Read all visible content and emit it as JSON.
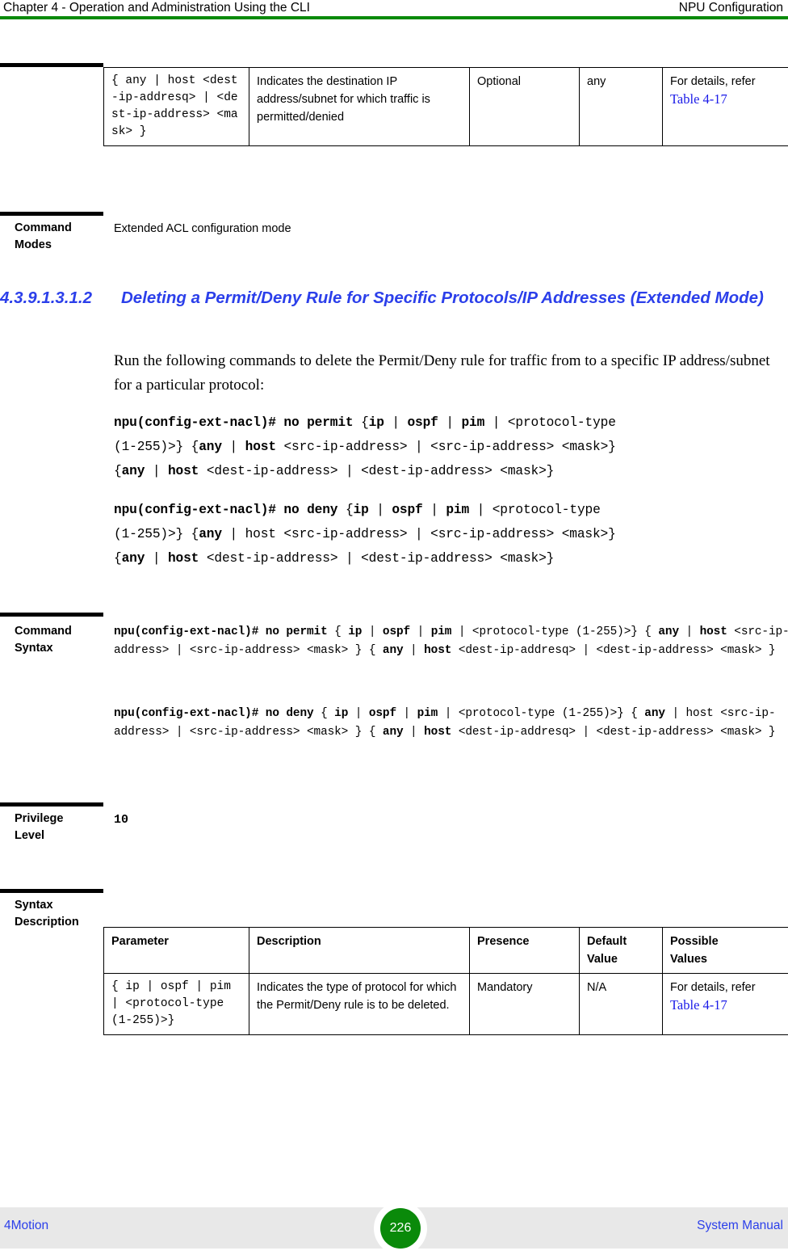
{
  "header": {
    "left": "Chapter 4 - Operation and Administration Using the CLI",
    "right": "NPU Configuration",
    "rule_color": "#0a8a0a"
  },
  "top_table": {
    "row": {
      "parameter": "{ any | host <dest-ip-addresq> | <dest-ip-address> <mask> }",
      "description": "Indicates the destination IP address/subnet for which traffic is permitted/denied",
      "presence": "Optional",
      "default_value": "any",
      "possible_values_prefix": "For details, refer",
      "possible_values_link": "Table 4-17"
    }
  },
  "command_modes": {
    "label_line1": "Command",
    "label_line2": "Modes",
    "value": "Extended ACL configuration mode"
  },
  "heading": {
    "number": "4.3.9.1.3.1.2",
    "text": "Deleting a Permit/Deny Rule for Specific Protocols/IP Addresses (Extended Mode)",
    "color": "#2b3fea"
  },
  "intro_paragraph": "Run the following commands to delete the Permit/Deny rule for traffic from to a specific IP address/subnet for a particular protocol:",
  "cli_commands": {
    "permit": {
      "line1_bold_a": "npu(config-ext-nacl)# no permit ",
      "line1_rest_open": "{",
      "line1_ip": "ip",
      "line1_sep1": " | ",
      "line1_ospf": "ospf",
      "line1_sep2": " | ",
      "line1_pim": "pim",
      "line1_sep3": " | ",
      "line1_tail": "<protocol-type",
      "line2_a": "(1-255)>} {",
      "line2_any": "any",
      "line2_b": " | ",
      "line2_host": "host",
      "line2_c": " <src-ip-address> | <src-ip-address> <mask>}",
      "line3_open": "{",
      "line3_any": "any",
      "line3_b": " | ",
      "line3_host": "host",
      "line3_c": " <dest-ip-address> | <dest-ip-address> <mask>}"
    },
    "deny": {
      "line1_bold_a": "npu(config-ext-nacl)# no deny ",
      "line1_rest_open": "{",
      "line1_ip": "ip",
      "line1_sep1": " | ",
      "line1_ospf": "ospf",
      "line1_sep2": " | ",
      "line1_pim": "pim",
      "line1_sep3": " | ",
      "line1_tail": "<protocol-type",
      "line2_a": "(1-255)>} {",
      "line2_any": "any",
      "line2_b": " | host <src-ip-address> | <src-ip-address> <mask>}",
      "line3_open": "{",
      "line3_any": "any",
      "line3_b": " | ",
      "line3_host": "host",
      "line3_c": " <dest-ip-address> | <dest-ip-address> <mask>}"
    }
  },
  "command_syntax": {
    "label_line1": "Command",
    "label_line2": "Syntax",
    "permit": {
      "p1": "npu(config-ext-nacl)# no permit",
      "p2": " { ",
      "p3": "ip",
      "p4": " | ",
      "p5": "ospf",
      "p6": " | ",
      "p7": "pim",
      "p8": " | <protocol-type (1-255)>} { ",
      "p9": "any",
      "p10": " | ",
      "p11": "host",
      "p12": " <src-ip-address> | <src-ip-address> <mask> } { ",
      "p13": "any",
      "p14": " | ",
      "p15": "host",
      "p16": " <dest-ip-addresq> | <dest-ip-address> <mask> }"
    },
    "deny": {
      "p1": "npu(config-ext-nacl)# no deny",
      "p2": " { ",
      "p3": "ip",
      "p4": " | ",
      "p5": "ospf",
      "p6": " | ",
      "p7": "pim",
      "p8": " | <protocol-type (1-255)>}",
      "p9": " { ",
      "p10": "any",
      "p11": " | host <src-ip-address> | <src-ip-address> <mask> } { ",
      "p12": "any",
      "p13": " | ",
      "p14": "host",
      "p15": " <dest-ip-addresq> | <dest-ip-address> <mask> }"
    }
  },
  "privilege_level": {
    "label_line1": "Privilege",
    "label_line2": "Level",
    "value": "10"
  },
  "syntax_description": {
    "label_line1": "Syntax",
    "label_line2": "Description",
    "columns": [
      "Parameter",
      "Description",
      "Presence",
      "Default Value",
      "Possible Values"
    ],
    "column_headers": {
      "parameter": "Parameter",
      "description": "Description",
      "presence": "Presence",
      "default_value_line1": "Default",
      "default_value_line2": "Value",
      "possible_values_line1": "Possible",
      "possible_values_line2": "Values"
    },
    "rows": [
      {
        "parameter": "{ ip | ospf | pim | <protocol-type (1-255)>}",
        "description": "Indicates the type of protocol for which the Permit/Deny rule is to be deleted.",
        "presence": "Mandatory",
        "default_value": "N/A",
        "possible_values_prefix": "For details, refer",
        "possible_values_link": "Table 4-17"
      }
    ]
  },
  "footer": {
    "left": "4Motion",
    "page_number": "226",
    "right": "System Manual",
    "badge_color": "#0a8a0a",
    "link_color": "#2b3fea",
    "background": "#e8e8e8"
  }
}
